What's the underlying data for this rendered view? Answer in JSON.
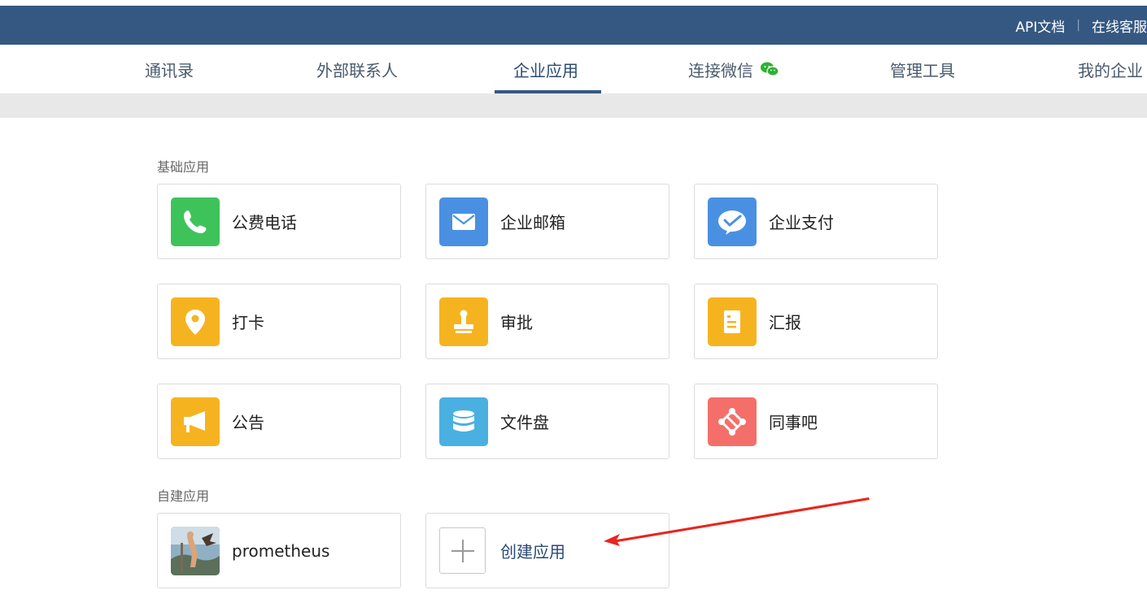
{
  "topbar": {
    "api_docs": "API文档",
    "separator": "|",
    "online_support": "在线客服"
  },
  "nav": {
    "tabs": [
      {
        "label": "通讯录"
      },
      {
        "label": "外部联系人"
      },
      {
        "label": "企业应用",
        "active": true
      },
      {
        "label": "连接微信",
        "icon": "wechat-icon"
      },
      {
        "label": "管理工具"
      },
      {
        "label": "我的企业"
      }
    ]
  },
  "basic_apps": {
    "title": "基础应用",
    "items": [
      {
        "label": "公费电话",
        "icon": "phone-icon",
        "color": "#3ec35b"
      },
      {
        "label": "企业邮箱",
        "icon": "mail-icon",
        "color": "#4a90e2"
      },
      {
        "label": "企业支付",
        "icon": "pay-icon",
        "color": "#4a90e2"
      },
      {
        "label": "打卡",
        "icon": "location-pin-icon",
        "color": "#f5b41f"
      },
      {
        "label": "审批",
        "icon": "stamp-icon",
        "color": "#f5b41f"
      },
      {
        "label": "汇报",
        "icon": "report-icon",
        "color": "#f5b41f"
      },
      {
        "label": "公告",
        "icon": "megaphone-icon",
        "color": "#f5b41f"
      },
      {
        "label": "文件盘",
        "icon": "database-icon",
        "color": "#4ab0e2"
      },
      {
        "label": "同事吧",
        "icon": "network-icon",
        "color": "#f46f6a"
      }
    ]
  },
  "custom_apps": {
    "title": "自建应用",
    "items": [
      {
        "label": "prometheus",
        "icon": "prometheus-app-icon"
      },
      {
        "label": "创建应用",
        "icon": "plus-icon"
      }
    ]
  },
  "annotation": {
    "color": "#e8261f",
    "icon": "red-arrow"
  }
}
